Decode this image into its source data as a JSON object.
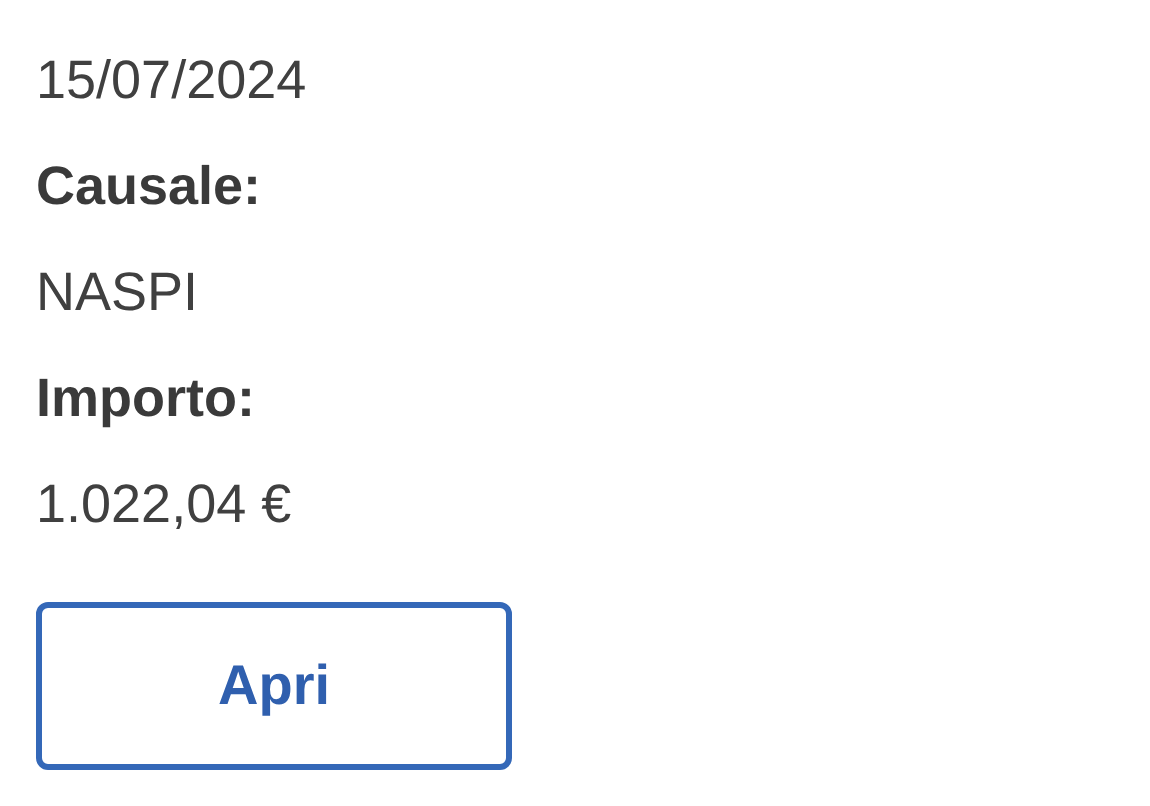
{
  "lines": [
    {
      "kind": "value",
      "text": "15/07/2024"
    },
    {
      "kind": "label",
      "text": "Causale:"
    },
    {
      "kind": "value",
      "text": "NASPI"
    },
    {
      "kind": "label",
      "text": "Importo:"
    },
    {
      "kind": "value",
      "text": "1.022,04 €"
    }
  ],
  "button": {
    "label": "Apri"
  }
}
